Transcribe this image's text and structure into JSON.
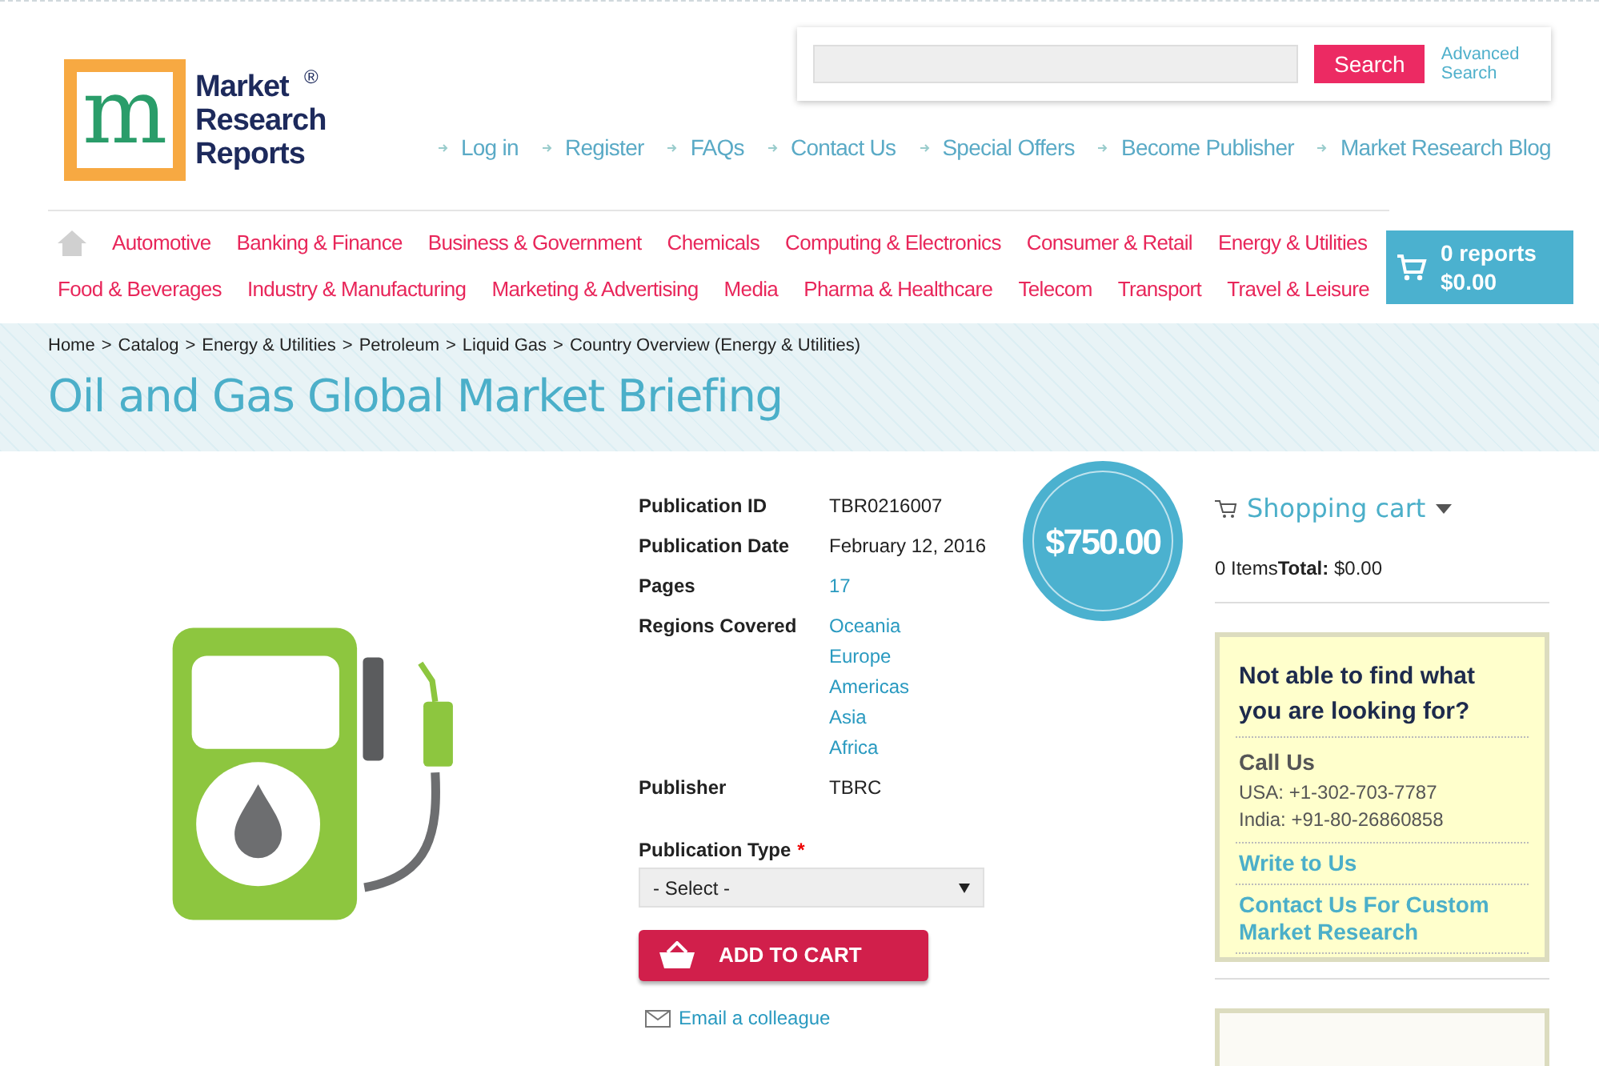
{
  "logo": {
    "letter": "m",
    "lines": [
      "Market",
      "Research",
      "Reports"
    ],
    "mark": "®"
  },
  "search": {
    "button": "Search",
    "advanced": "Advanced Search"
  },
  "top_links": [
    "Log in",
    "Register",
    "FAQs",
    "Contact Us",
    "Special Offers",
    "Become Publisher",
    "Market Research Blog"
  ],
  "categories": [
    [
      "Automotive",
      "Banking & Finance",
      "Business & Government",
      "Chemicals",
      "Computing & Electronics",
      "Consumer & Retail",
      "Energy & Utilities"
    ],
    [
      "Food & Beverages",
      "Industry & Manufacturing",
      "Marketing & Advertising",
      "Media",
      "Pharma & Healthcare",
      "Telecom",
      "Transport",
      "Travel & Leisure"
    ]
  ],
  "cart_button": {
    "count": "0 reports",
    "total": "$0.00"
  },
  "breadcrumb": [
    "Home",
    "Catalog",
    "Energy & Utilities",
    "Petroleum",
    "Liquid Gas",
    "Country Overview (Energy & Utilities)"
  ],
  "breadcrumb_separator": ">",
  "title": "Oil and Gas Global Market Briefing",
  "details": [
    {
      "label": "Publication ID",
      "values": [
        "TBR0216007"
      ],
      "kind": "text"
    },
    {
      "label": "Publication Date",
      "values": [
        "February 12, 2016"
      ],
      "kind": "text"
    },
    {
      "label": "Pages",
      "values": [
        "17"
      ],
      "kind": "link"
    },
    {
      "label": "Regions Covered",
      "values": [
        "Oceania",
        "Europe",
        "Americas",
        "Asia",
        "Africa"
      ],
      "kind": "link"
    },
    {
      "label": "Publisher",
      "values": [
        "TBRC"
      ],
      "kind": "text"
    }
  ],
  "price": "$750.00",
  "publication_type": {
    "label": "Publication Type",
    "required": "*",
    "value": "- Select -"
  },
  "add_to_cart": "ADD TO CART",
  "email_link": "Email a colleague",
  "sidebar": {
    "cart_title": "Shopping cart",
    "items": "0 Items",
    "total_label": "Total:",
    "total": "$0.00",
    "help_title": "Not able to find what you are looking for?",
    "call_title": "Call Us",
    "phones": [
      "USA: +1-302-703-7787",
      "India: +91-80-26860858"
    ],
    "links": [
      "Write to Us",
      "Contact Us For Custom Market Research"
    ]
  }
}
